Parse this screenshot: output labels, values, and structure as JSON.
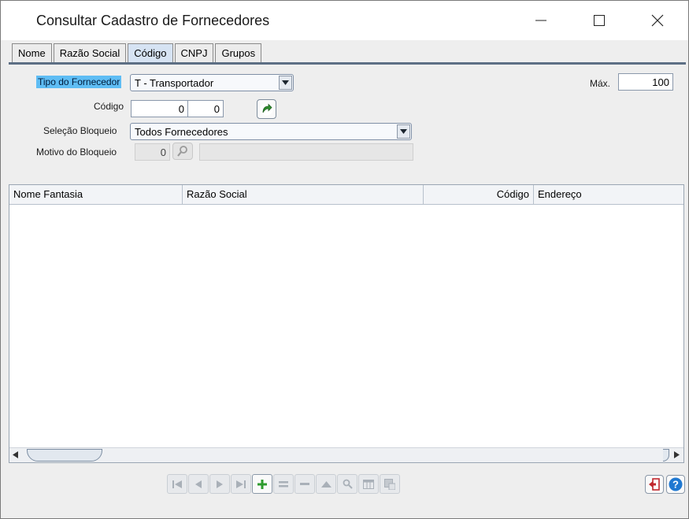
{
  "window": {
    "title": "Consultar Cadastro de Fornecedores"
  },
  "tabs": [
    {
      "label": "Nome",
      "active": false
    },
    {
      "label": "Razão Social",
      "active": false
    },
    {
      "label": "Código",
      "active": true
    },
    {
      "label": "CNPJ",
      "active": false
    },
    {
      "label": "Grupos",
      "active": false
    }
  ],
  "form": {
    "tipo_label": "Tipo do Fornecedor",
    "tipo_value": "T - Transportador",
    "max_label": "Máx.",
    "max_value": "100",
    "codigo_label": "Código",
    "codigo_from": "0",
    "codigo_to": "0",
    "bloqueio_label": "Seleção Bloqueio",
    "bloqueio_value": "Todos Fornecedores",
    "motivo_label": "Motivo do Bloqueio",
    "motivo_code": "0",
    "motivo_desc": ""
  },
  "grid": {
    "columns": [
      "Nome Fantasia",
      "Razão Social",
      "Código",
      "Endereço"
    ],
    "rows": []
  },
  "colors": {
    "highlight": "#5fbdf4",
    "active_tab": "#d6e3f3",
    "tab_line": "#5d6f84",
    "go_icon": "#2f8f2f",
    "add_icon": "#2e9b2e",
    "exit_icon": "#c0272d",
    "help_icon": "#1f78d1"
  },
  "icons": {
    "go": "green-curved-arrow",
    "lookup": "magnifier",
    "exit": "door-exit",
    "help": "question-mark"
  }
}
